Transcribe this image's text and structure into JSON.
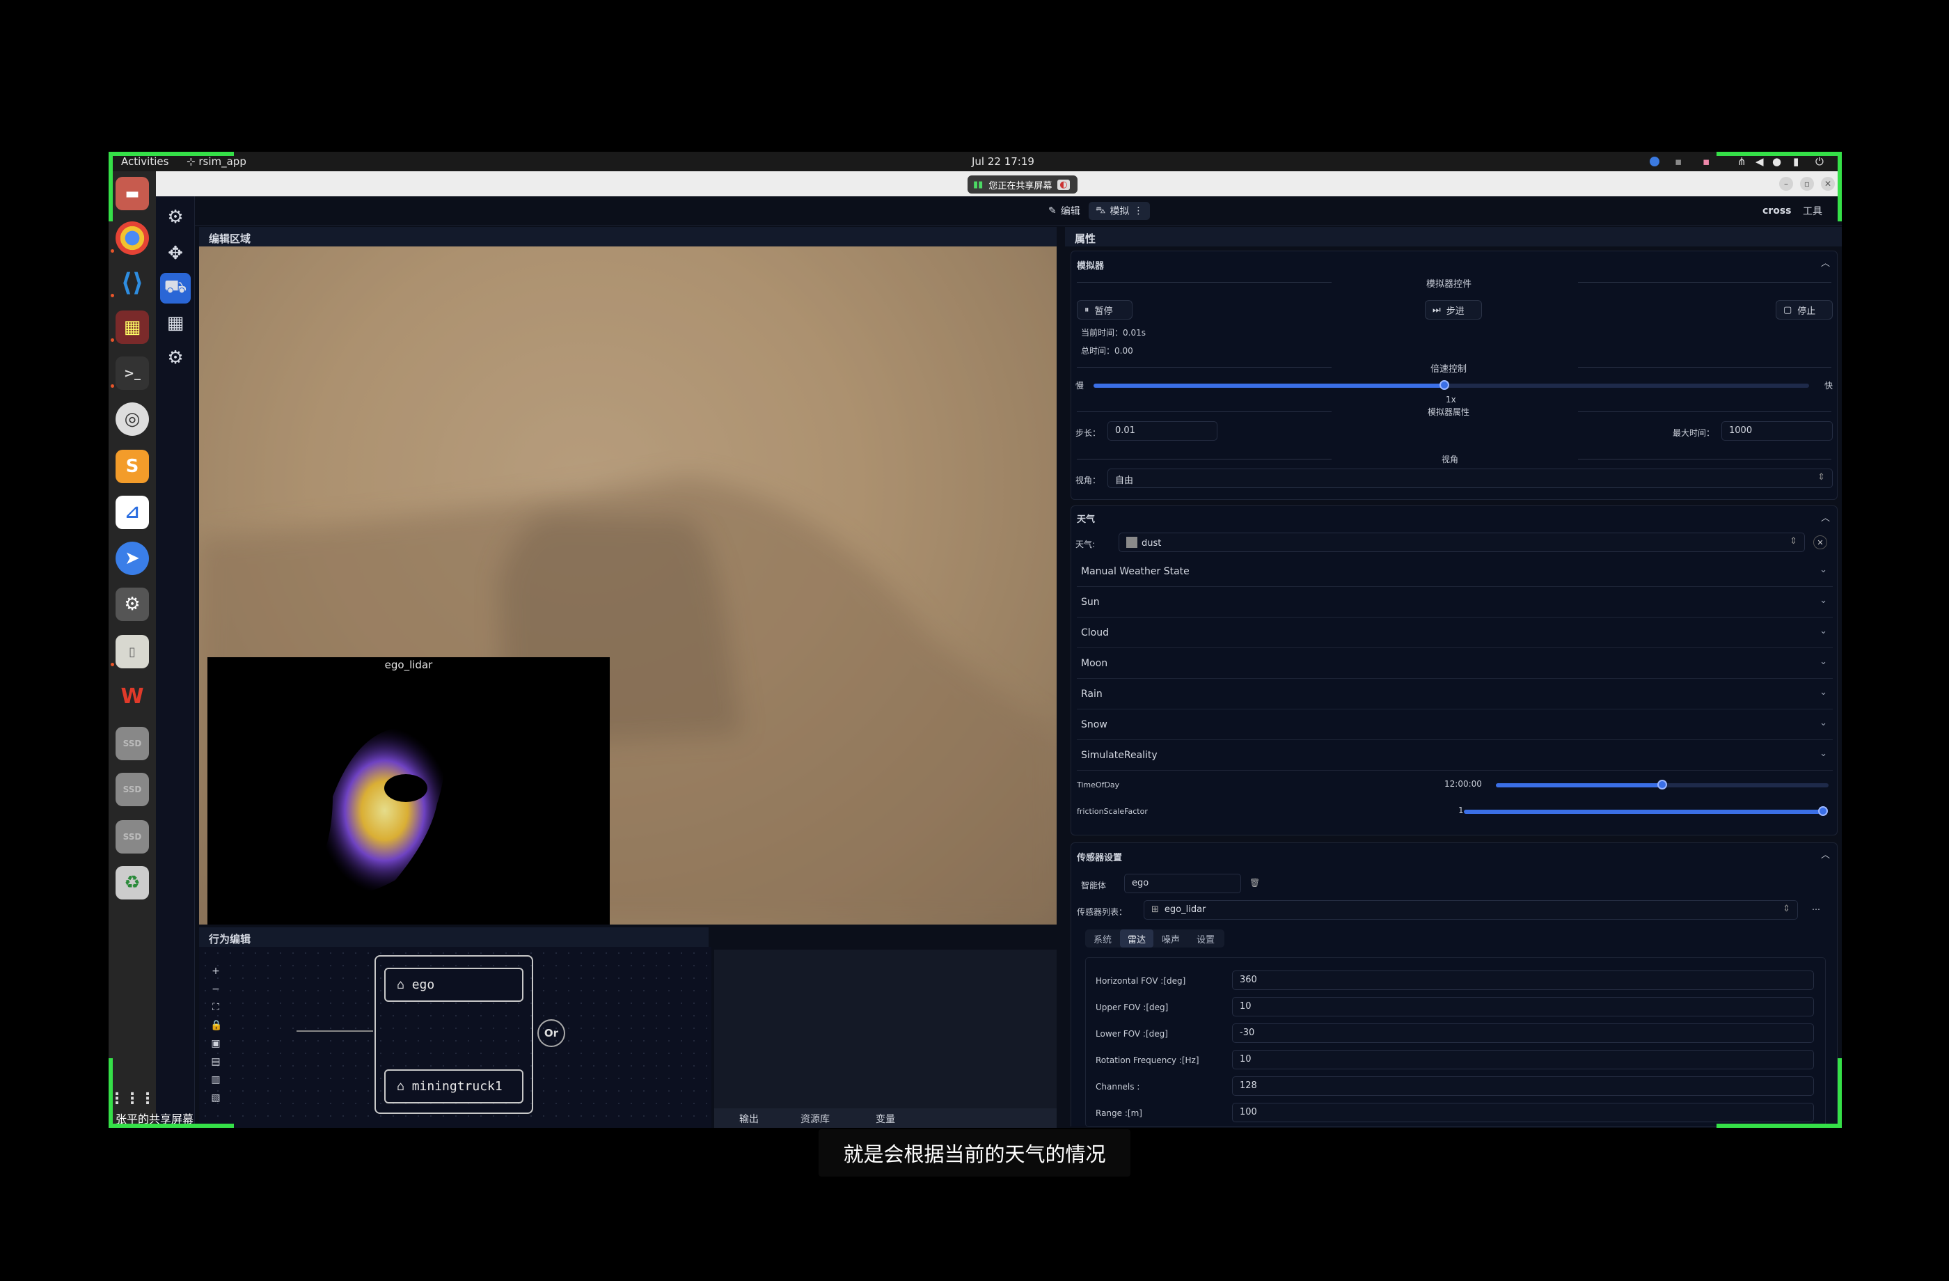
{
  "topbar": {
    "activities": "Activities",
    "app": "rsim_app",
    "datetime": "Jul 22  17:19"
  },
  "share": {
    "banner": "您正在共享屏幕",
    "presenter": "张平的共享屏幕"
  },
  "header": {
    "edit": "编辑",
    "simulate": "模拟",
    "user": "cross",
    "tools": "工具"
  },
  "panels": {
    "edit_area": "编辑区域",
    "properties": "属性",
    "behavior": "行为编辑"
  },
  "viewport": {
    "lidar_title": "ego_lidar"
  },
  "behavior": {
    "nodes": [
      "ego",
      "miningtruck1"
    ],
    "or_label": "Or"
  },
  "output_tabs": [
    "输出",
    "资源库",
    "变量"
  ],
  "simulator": {
    "title": "模拟器",
    "controls_title": "模拟器控件",
    "pause": "暂停",
    "step": "步进",
    "stop": "停止",
    "current_time": "当前时间：0.01s",
    "total_time": "总时间：0.00",
    "speed_title": "倍速控制",
    "slow": "慢",
    "fast": "快",
    "speed_value": "1x",
    "speed_fraction": 0.49,
    "props_title": "模拟器属性",
    "step_label": "步长：",
    "step_value": "0.01",
    "max_time_label": "最大时间：",
    "max_time_value": "1000",
    "view_title": "视角",
    "view_label": "视角：",
    "view_value": "自由"
  },
  "weather": {
    "title": "天气",
    "label": "天气:",
    "value": "dust",
    "groups": [
      "Manual Weather State",
      "Sun",
      "Cloud",
      "Moon",
      "Rain",
      "Snow",
      "SimulateReality"
    ],
    "time_of_day_label": "TimeOfDay",
    "time_of_day_value": "12:00:00",
    "time_of_day_fraction": 0.5,
    "friction_label": "frictionScaleFactor",
    "friction_value": "1",
    "friction_fraction": 1.0
  },
  "sensor": {
    "title": "传感器设置",
    "agent_label": "智能体",
    "agent_value": "ego",
    "list_label": "传感器列表：",
    "list_value": "ego_lidar",
    "tabs": [
      "系统",
      "雷达",
      "噪声",
      "设置"
    ],
    "active_tab": "雷达",
    "fields": [
      {
        "label": "Horizontal FOV :[deg]",
        "value": "360"
      },
      {
        "label": "Upper FOV :[deg]",
        "value": "10"
      },
      {
        "label": "Lower FOV :[deg]",
        "value": "-30"
      },
      {
        "label": "Rotation Frequency :[Hz]",
        "value": "10"
      },
      {
        "label": "Channels :",
        "value": "128"
      },
      {
        "label": "Range :[m]",
        "value": "100"
      }
    ]
  },
  "caption": "就是会根据当前的天气的情况",
  "colors": {
    "accent": "#3b6fe6",
    "share_frame": "#35e048",
    "panel_bg": "#0b0f1a"
  }
}
